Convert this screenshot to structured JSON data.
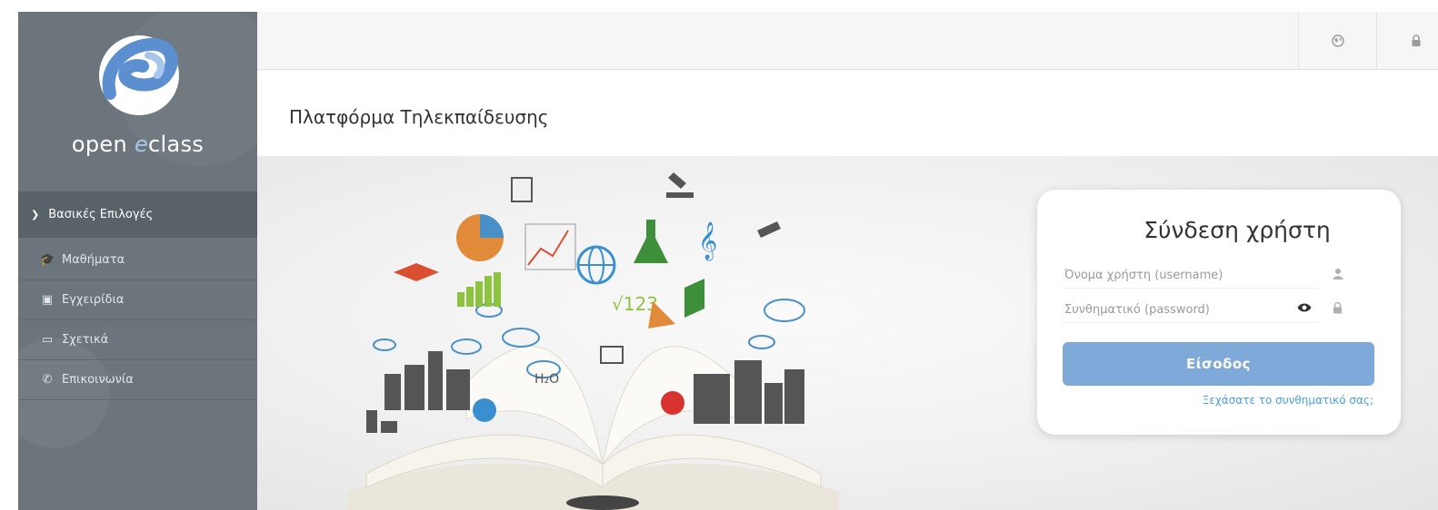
{
  "sidebar": {
    "logo_text_prefix": "open ",
    "logo_text_accent": "e",
    "logo_text_suffix": "class",
    "section_label": "Βασικές Επιλογές",
    "items": [
      {
        "label": "Μαθήματα",
        "icon": "graduation-cap-icon"
      },
      {
        "label": "Εγχειρίδια",
        "icon": "file-video-icon"
      },
      {
        "label": "Σχετικά",
        "icon": "credit-card-icon"
      },
      {
        "label": "Επικοινωνία",
        "icon": "phone-icon"
      }
    ]
  },
  "header": {
    "icons": [
      "globe-icon",
      "lock-icon"
    ]
  },
  "page": {
    "title": "Πλατφόρμα Τηλεκπαίδευσης"
  },
  "login": {
    "title": "Σύνδεση χρήστη",
    "username_placeholder": "Όνομα χρήστη (username)",
    "password_placeholder": "Συνθηματικό (password)",
    "button_label": "Είσοδος",
    "forgot_link": "Ξεχάσατε το συνθηματικό σας;"
  },
  "hero": {
    "illustration_labels": [
      "√123",
      "H₂O"
    ]
  },
  "colors": {
    "sidebar_bg": "#6b757b",
    "sidebar_header_bg": "#596268",
    "button_bg": "#7ea9d9",
    "link": "#4aa1dd"
  }
}
